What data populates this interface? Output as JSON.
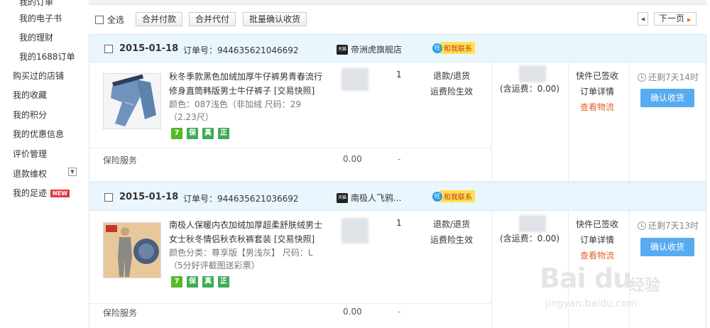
{
  "sidebar": {
    "items": [
      {
        "label": "我的订单",
        "type": "sub"
      },
      {
        "label": "我的电子书",
        "type": "sub"
      },
      {
        "label": "我的理财",
        "type": "sub"
      },
      {
        "label": "我的1688订单",
        "type": "sub"
      },
      {
        "label": "购买过的店铺",
        "type": "main"
      },
      {
        "label": "我的收藏",
        "type": "main"
      },
      {
        "label": "我的积分",
        "type": "main"
      },
      {
        "label": "我的优惠信息",
        "type": "main"
      },
      {
        "label": "评价管理",
        "type": "main"
      },
      {
        "label": "退款维权",
        "type": "main"
      },
      {
        "label": "我的足迹",
        "type": "main",
        "badge": "NEW"
      }
    ]
  },
  "toolbar": {
    "select_all": "全选",
    "merge_pay": "合并付款",
    "merge_agent_pay": "合并代付",
    "batch_confirm": "批量确认收货",
    "next_page": "下一页"
  },
  "orders": [
    {
      "date": "2015-01-18",
      "order_no": "订单号：944635621046692",
      "shop": "帝洲虎旗舰店",
      "contact": "和我联系",
      "title": "秋冬季款黑色加绒加厚牛仔裤男青春流行修身直筒韩版男士牛仔裤子 [交易快照]",
      "sku": "颜色：087浅色（非加绒 尺码：29（2.23尺）",
      "qty": "1",
      "refund": "退款/退货",
      "insurance_effective": "运费险生效",
      "insurance_label": "保险服务",
      "insurance_price": "0.00",
      "insurance_dash": "-",
      "shipping": "(含运费：0.00)",
      "status": "快件已签收",
      "detail": "订单详情",
      "logistics": "查看物流",
      "remaining": "还剩7天14时",
      "confirm": "确认收货"
    },
    {
      "date": "2015-01-18",
      "order_no": "订单号：944635621036692",
      "shop": "南极人飞鸦...",
      "contact": "和我联系",
      "title": "南极人保暖内衣加绒加厚超柔舒肤绒男士女士秋冬情侣秋衣秋裤套装 [交易快照]",
      "sku": "颜色分类：尊享版【男浅灰】 尺码：L（5分好评截图送彩票）",
      "qty": "1",
      "refund": "退款/退货",
      "insurance_effective": "运费险生效",
      "insurance_label": "保险服务",
      "insurance_price": "0.00",
      "insurance_dash": "-",
      "shipping": "(含运费：0.00)",
      "status": "快件已签收",
      "detail": "订单详情",
      "logistics": "查看物流",
      "remaining": "还剩7天13时",
      "confirm": "确认收货"
    }
  ],
  "tags": [
    "7",
    "保",
    "真",
    "正"
  ],
  "tmall_icon": "天猫",
  "wangwang_icon": "旺",
  "watermark": {
    "logo": "Bai du",
    "brand_cn": "经验",
    "url": "jingyan.baidu.com"
  },
  "colors": {
    "order_header_bg": "#eaf6fd",
    "confirm_button": "#57abf0",
    "logistics_link": "#e4602a",
    "tag_green": "#3dac55",
    "new_badge": "#e4393c"
  }
}
